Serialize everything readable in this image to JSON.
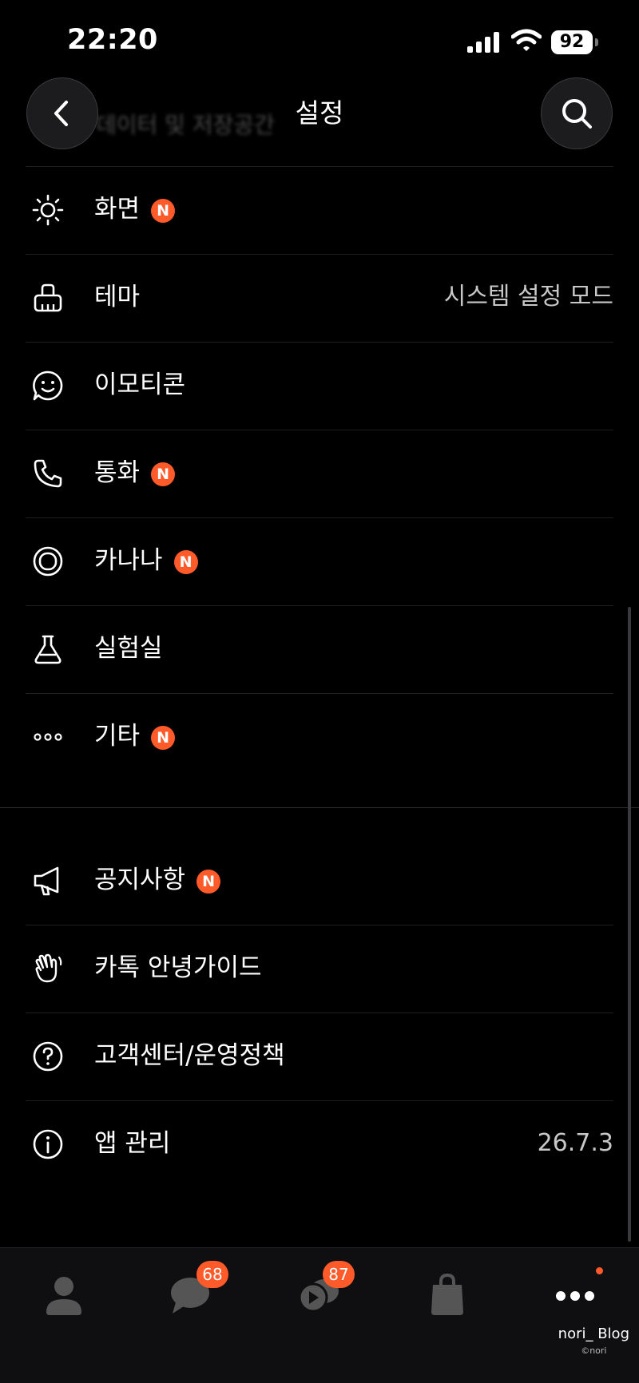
{
  "status": {
    "time": "22:20",
    "battery": "92"
  },
  "header": {
    "title": "설정",
    "behind_text": "데이터 및 저장공간"
  },
  "section1": [
    {
      "label": "화면",
      "icon": "sun-icon",
      "new_badge": "N"
    },
    {
      "label": "테마",
      "icon": "paint-brush-icon",
      "value": "시스템 설정 모드"
    },
    {
      "label": "이모티콘",
      "icon": "emoticon-icon"
    },
    {
      "label": "통화",
      "icon": "phone-icon",
      "new_badge": "N"
    },
    {
      "label": "카나나",
      "icon": "kanana-icon",
      "new_badge": "N"
    },
    {
      "label": "실험실",
      "icon": "flask-icon"
    },
    {
      "label": "기타",
      "icon": "more-icon",
      "new_badge": "N"
    }
  ],
  "section2": [
    {
      "label": "공지사항",
      "icon": "megaphone-icon",
      "new_badge": "N"
    },
    {
      "label": "카톡 안녕가이드",
      "icon": "waving-hand-icon"
    },
    {
      "label": "고객센터/운영정책",
      "icon": "help-icon"
    },
    {
      "label": "앱 관리",
      "icon": "info-icon",
      "value": "26.7.3"
    }
  ],
  "tabs": [
    {
      "name": "friends",
      "icon": "person-icon"
    },
    {
      "name": "chats",
      "icon": "chat-bubble-icon",
      "badge": "68"
    },
    {
      "name": "openchat",
      "icon": "openchat-icon",
      "badge": "87"
    },
    {
      "name": "shopping",
      "icon": "shopping-bag-icon"
    },
    {
      "name": "more",
      "icon": "more-dots-icon",
      "dot": true
    }
  ],
  "watermark": {
    "line1": "nori_ Blog",
    "line2": "©nori"
  },
  "colors": {
    "badge": "#ff5a2a",
    "background": "#000000",
    "text": "#ffffff"
  }
}
